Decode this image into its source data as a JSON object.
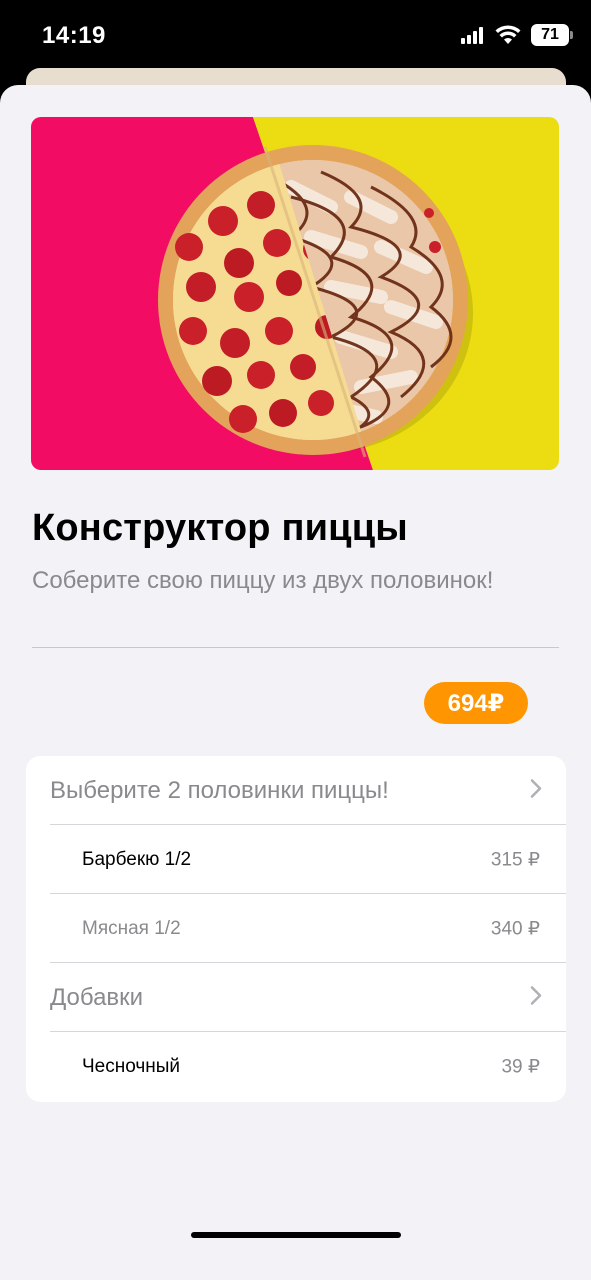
{
  "status_bar": {
    "time": "14:19",
    "battery": "71"
  },
  "product": {
    "title": "Конструктор пиццы",
    "subtitle": "Соберите свою пиццу из двух половинок!",
    "price": "694₽"
  },
  "options": {
    "halves_header": "Выберите 2 половинки пиццы!",
    "halves": [
      {
        "label": "Барбекю 1/2",
        "price": "315 ₽"
      },
      {
        "label": "Мясная 1/2",
        "price": "340 ₽"
      }
    ],
    "addons_header": "Добавки",
    "addons": [
      {
        "label": "Чесночный",
        "price": "39 ₽"
      }
    ]
  },
  "colors": {
    "hero_left": "#f30c63",
    "hero_right": "#ecdc12",
    "accent": "#ff9500"
  },
  "icons": [
    "signal-icon",
    "wifi-icon",
    "battery-icon",
    "chevron-right-icon"
  ]
}
